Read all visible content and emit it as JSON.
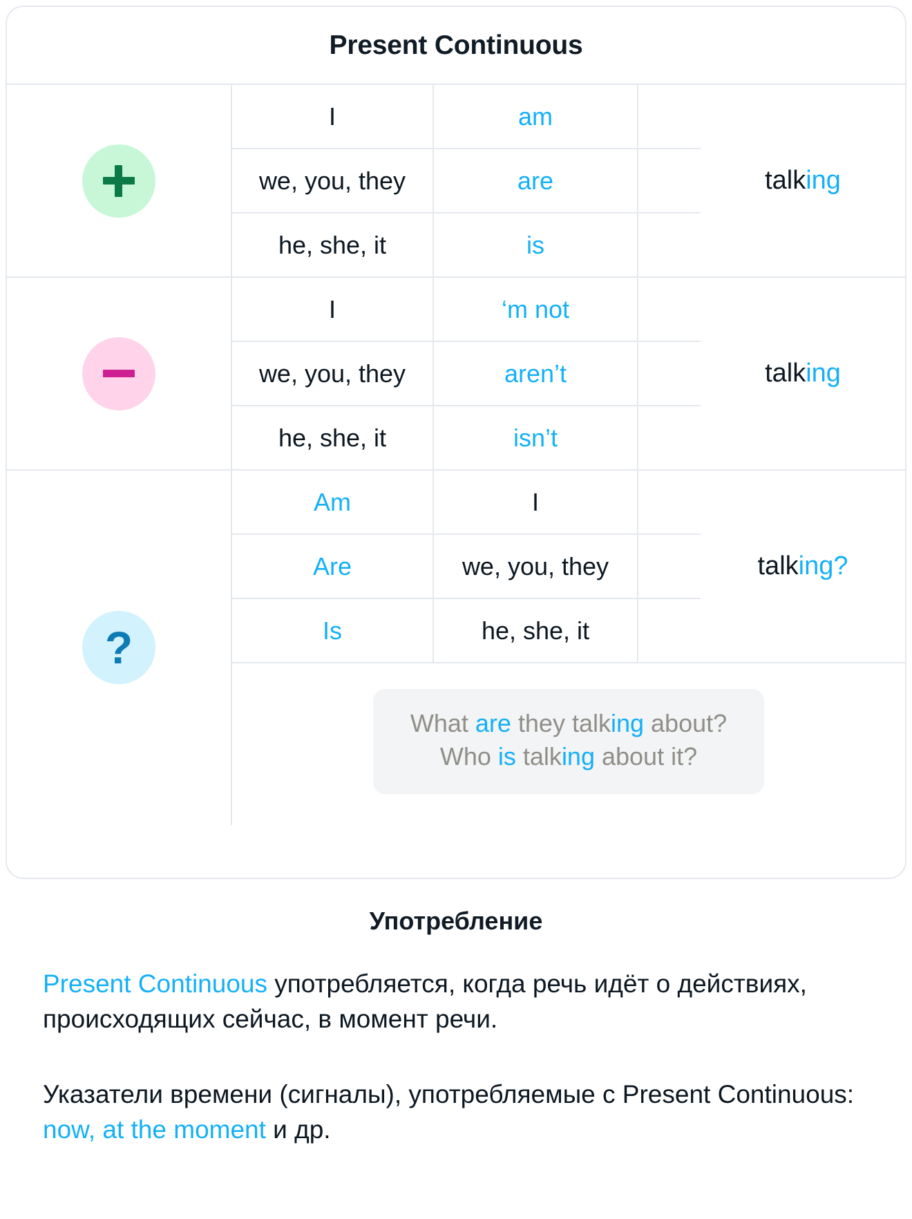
{
  "card": {
    "title": "Present Continuous",
    "sections": [
      {
        "id": "affirmative",
        "badge": {
          "name": "plus-badge",
          "symbol": "+",
          "bg": "#c8f7d8",
          "fg": "#0b7a46"
        },
        "rows": [
          {
            "subject": "I",
            "aux": "am"
          },
          {
            "subject": "we, you, they",
            "aux": "are"
          },
          {
            "subject": "he, she, it",
            "aux": "is"
          }
        ],
        "verb": {
          "stem": "talk",
          "suffix": "ing"
        }
      },
      {
        "id": "negative",
        "badge": {
          "name": "minus-badge",
          "symbol": "–",
          "bg": "#ffd4ea",
          "fg": "#cf1e92"
        },
        "rows": [
          {
            "subject": "I",
            "aux": "‘m not"
          },
          {
            "subject": "we, you, they",
            "aux": "aren’t"
          },
          {
            "subject": "he, she, it",
            "aux": "isn’t"
          }
        ],
        "verb": {
          "stem": "talk",
          "suffix": "ing"
        }
      },
      {
        "id": "question",
        "badge": {
          "name": "question-badge",
          "symbol": "?",
          "bg": "#d2f3fd",
          "fg": "#0d7cb5"
        },
        "rows": [
          {
            "aux": "Am",
            "subject": "I"
          },
          {
            "aux": "Are",
            "subject": "we, you, they"
          },
          {
            "aux": "Is",
            "subject": "he, she, it"
          }
        ],
        "verb": {
          "stem": "talk",
          "suffix": "ing?"
        }
      }
    ],
    "example": {
      "line1": {
        "a": "What ",
        "b": "are",
        "c": " they talk",
        "d": "ing",
        "e": " about?"
      },
      "line2": {
        "a": "Who ",
        "b": "is",
        "c": " talk",
        "d": "ing",
        "e": " about it?"
      }
    }
  },
  "usage": {
    "title": "Употребление",
    "p1": {
      "highlight": "Present Continuous",
      "rest": " употребляется, когда речь идёт о действиях, происходящих сейчас, в момент речи."
    },
    "p2": {
      "before": "Указатели времени (сигналы), употребляемые с Present Continuous: ",
      "highlight": "now, at the moment",
      "after": " и др."
    }
  },
  "colors": {
    "accent_blue": "#14b0f7",
    "text_dark": "#0c1721",
    "border": "#e4e8ee",
    "example_bg": "#f2f4f6",
    "example_text": "#918e88"
  }
}
